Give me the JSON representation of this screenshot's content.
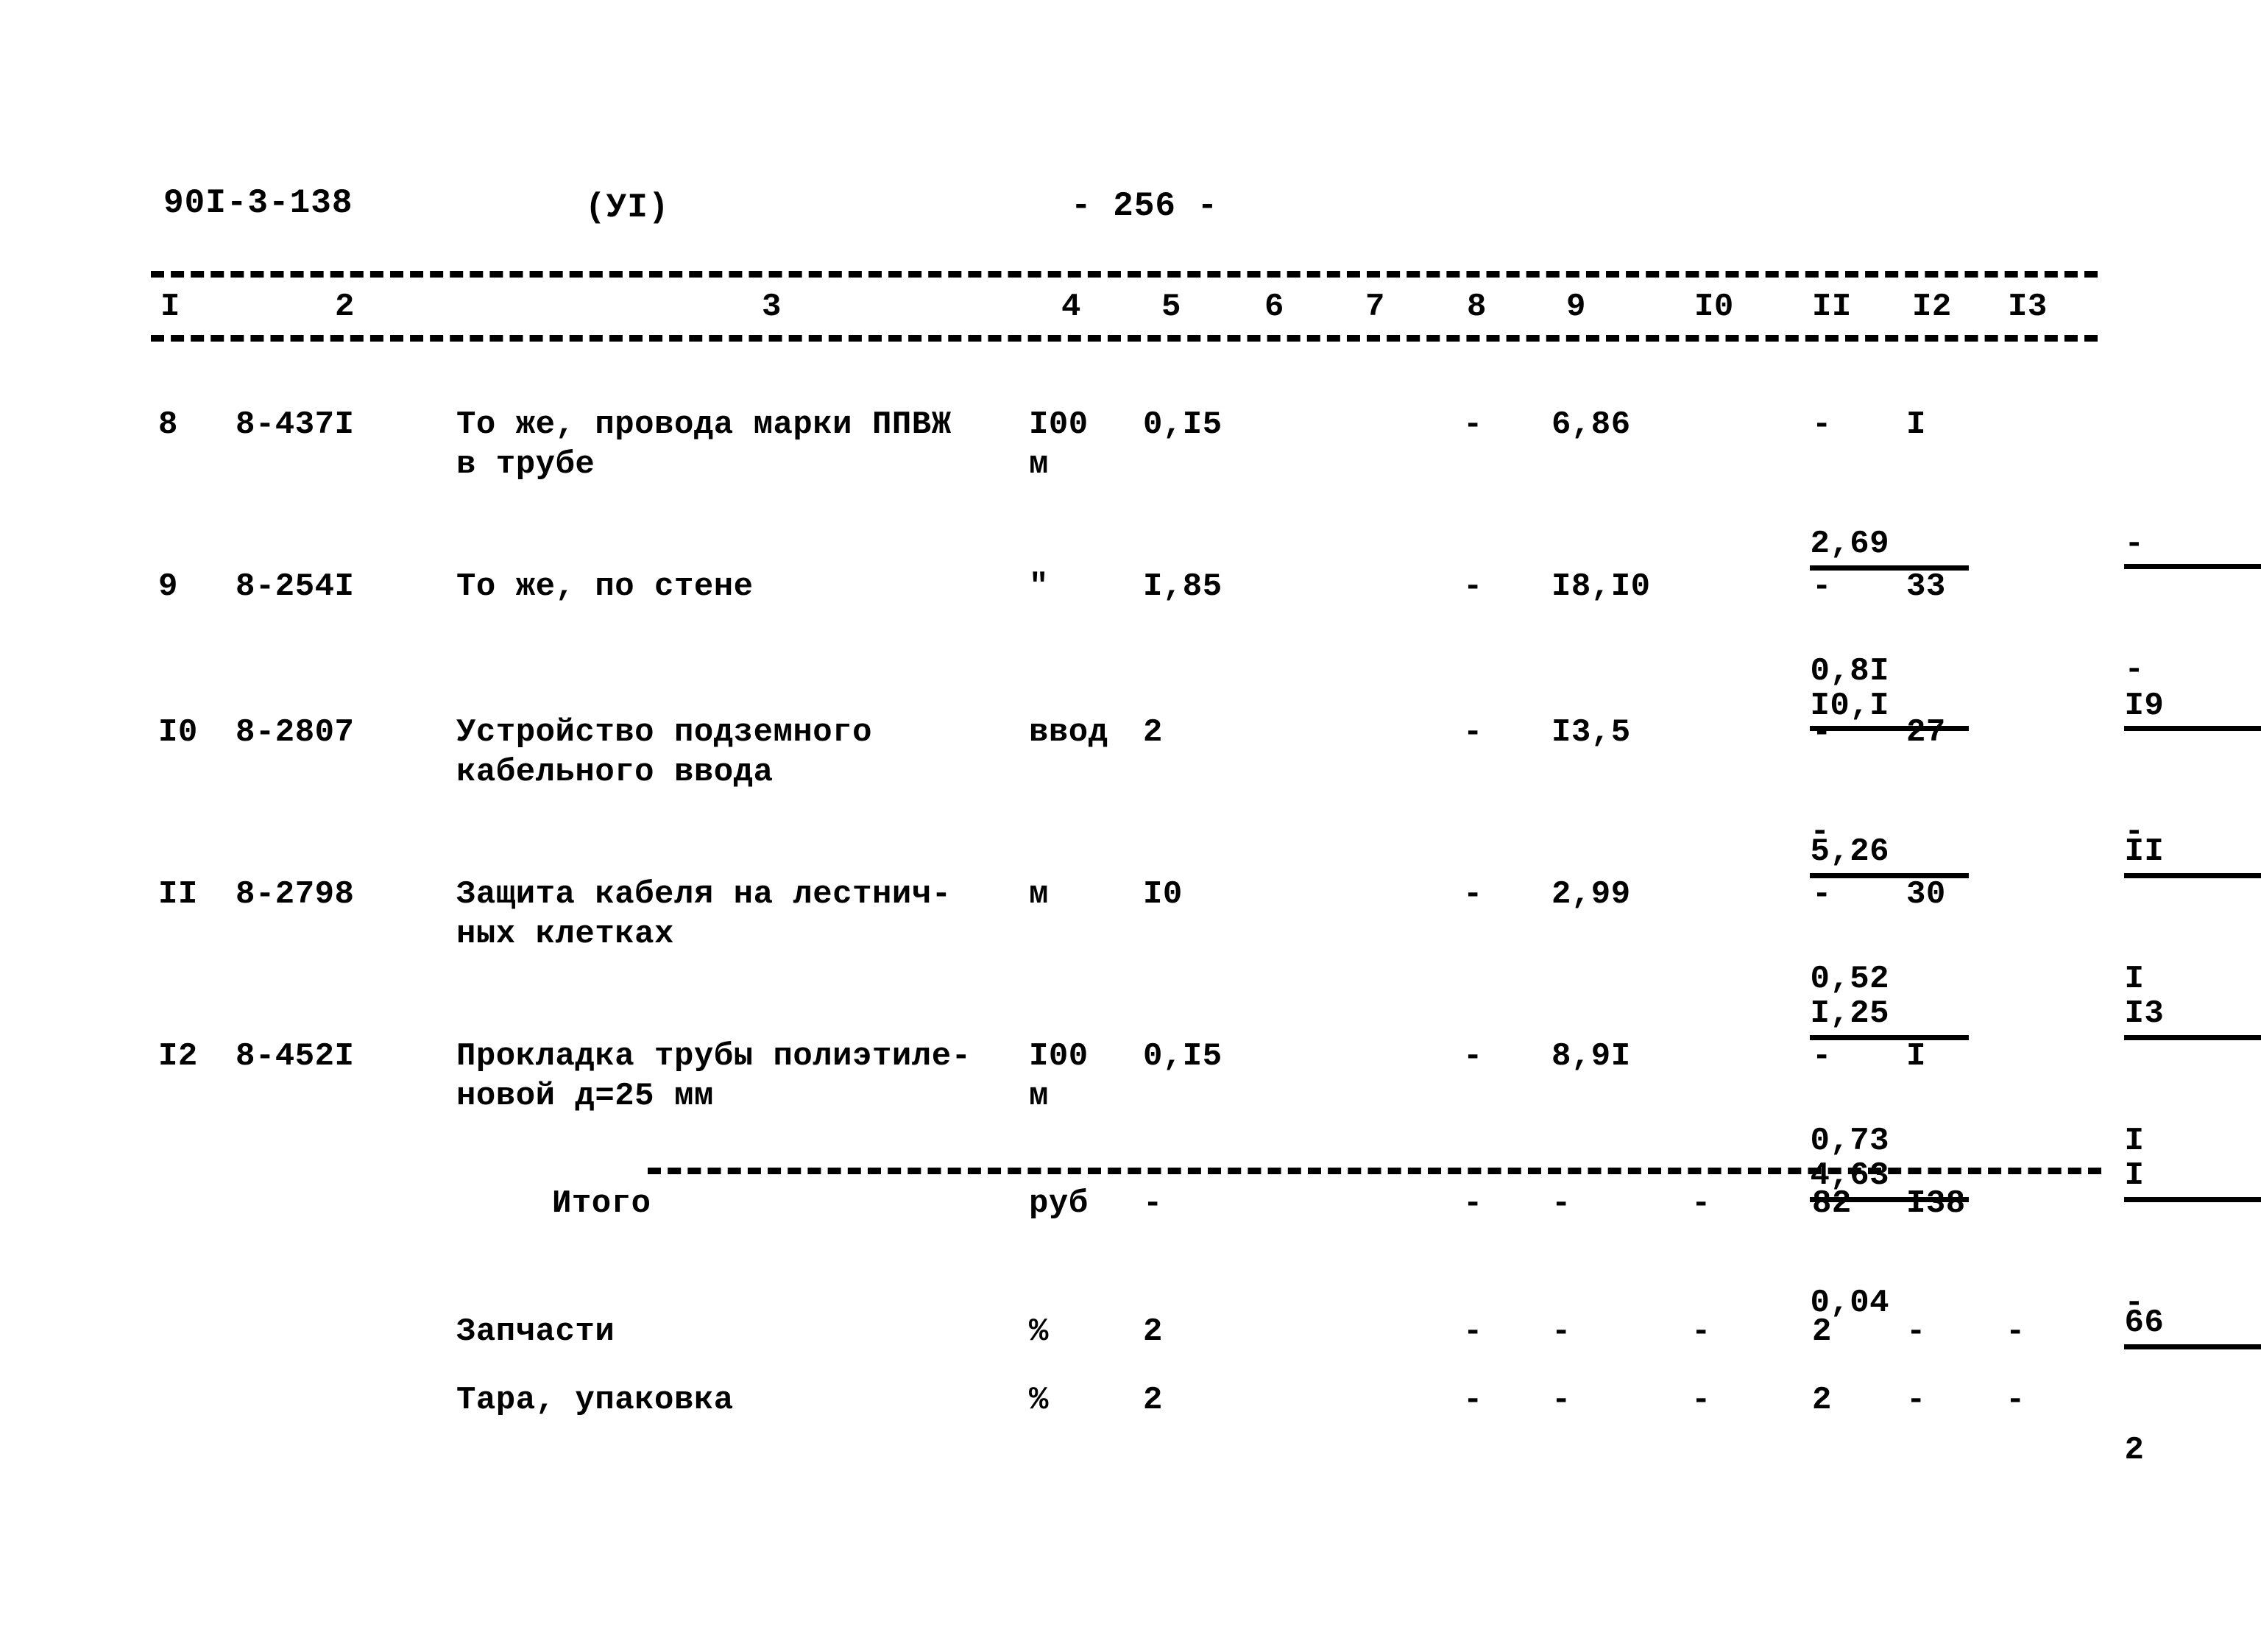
{
  "header": {
    "doc_code": "90I-3-138",
    "section": "(УI)",
    "page_number": "- 256 -"
  },
  "table": {
    "column_headers": [
      "I",
      "2",
      "3",
      "4",
      "5",
      "6",
      "7",
      "8",
      "9",
      "I0",
      "II",
      "I2",
      "I3"
    ],
    "rows": [
      {
        "num": "8",
        "code": "8-437I",
        "description": "То же, провода марки ППВЖ\nв трубе",
        "unit": "I00\nм",
        "qty": "0,I5",
        "c6": "",
        "c7": "",
        "c8": "-",
        "c9": "6,86",
        "c10_num": "2,69",
        "c10_den": "0,8I",
        "c11": "-",
        "c12": "I",
        "c13_num": "-",
        "c13_den": "-"
      },
      {
        "num": "9",
        "code": "8-254I",
        "description": "То же, по стене",
        "unit": "\"",
        "qty": "I,85",
        "c6": "",
        "c7": "",
        "c8": "-",
        "c9": "I8,I0",
        "c10_num": "I0,I",
        "c10_den": "-",
        "c11": "-",
        "c12": "33",
        "c13_num": "I9",
        "c13_den": "-"
      },
      {
        "num": "I0",
        "code": "8-2807",
        "description": "Устройство подземного\nкабельного ввода",
        "unit": "ввод",
        "qty": "2",
        "c6": "",
        "c7": "",
        "c8": "-",
        "c9": "I3,5",
        "c10_num": "5,26",
        "c10_den": "0,52",
        "c11": "-",
        "c12": "27",
        "c13_num": "II",
        "c13_den": "I"
      },
      {
        "num": "II",
        "code": "8-2798",
        "description": "Защита кабеля на лестнич-\nных клетках",
        "unit": "м",
        "qty": "I0",
        "c6": "",
        "c7": "",
        "c8": "-",
        "c9": "2,99",
        "c10_num": "I,25",
        "c10_den": "0,73",
        "c11": "-",
        "c12": "30",
        "c13_num": "I3",
        "c13_den": "I"
      },
      {
        "num": "I2",
        "code": "8-452I",
        "description": "Прокладка трубы полиэтиле-\nновой д=25 мм",
        "unit": "I00\nм",
        "qty": "0,I5",
        "c6": "",
        "c7": "",
        "c8": "-",
        "c9": "8,9I",
        "c10_num": "4,63",
        "c10_den": "0,04",
        "c11": "-",
        "c12": "I",
        "c13_num": "I",
        "c13_den": "-"
      }
    ],
    "total_row": {
      "label": "Итого",
      "unit": "руб",
      "qty": "-",
      "c8": "-",
      "c9": "-",
      "c10": "-",
      "c11": "82",
      "c12": "I38",
      "c13_num": "66",
      "c13_den": "2"
    },
    "extra_rows": [
      {
        "label": "Запчасти",
        "unit": "%",
        "qty": "2",
        "c8": "-",
        "c9": "-",
        "c10": "-",
        "c11": "2",
        "c12": "-",
        "c13": "-"
      },
      {
        "label": "Тара, упаковка",
        "unit": "%",
        "qty": "2",
        "c8": "-",
        "c9": "-",
        "c10": "-",
        "c11": "2",
        "c12": "-",
        "c13": "-"
      }
    ]
  }
}
